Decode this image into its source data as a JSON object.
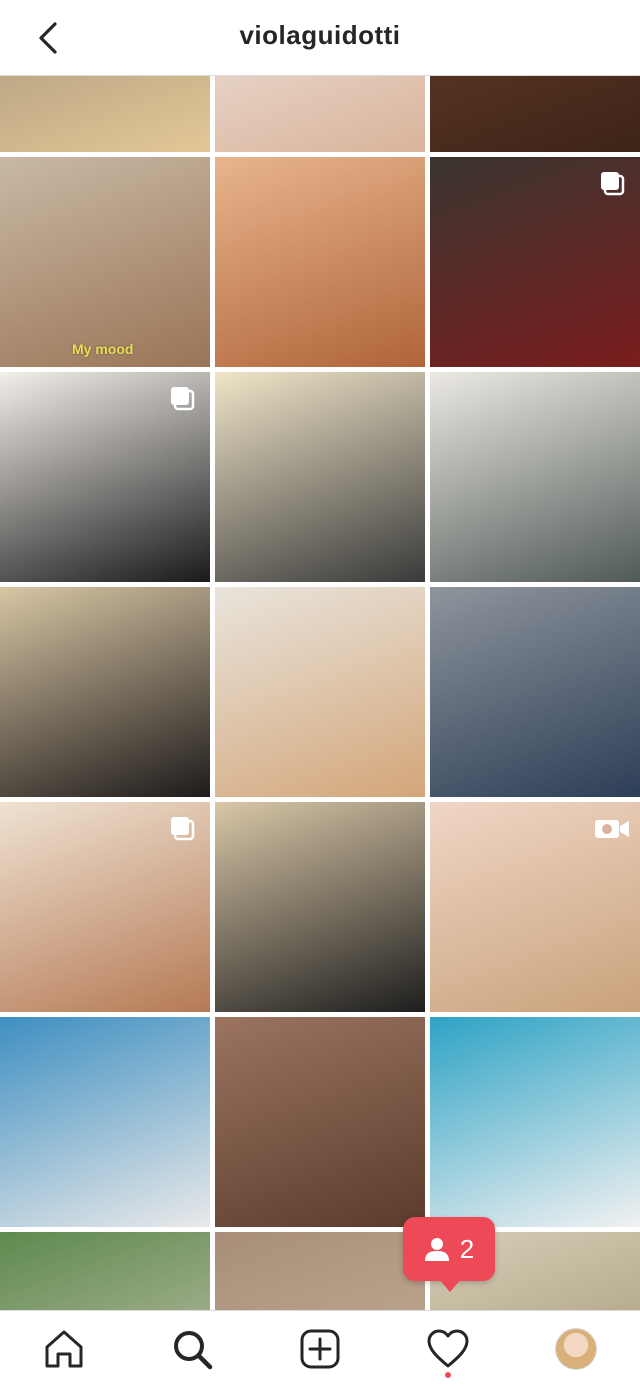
{
  "header": {
    "username": "violaguidotti"
  },
  "grid": {
    "tiles": [
      {
        "colors": [
          "#9c8c78",
          "#e3c896"
        ],
        "overlay": null
      },
      {
        "colors": [
          "#f1ece6",
          "#d9b39b"
        ],
        "overlay": null
      },
      {
        "colors": [
          "#6b3f28",
          "#3d2418"
        ],
        "overlay": null
      },
      {
        "colors": [
          "#c8b9a5",
          "#9b7456"
        ],
        "overlay": null,
        "caption": "My mood"
      },
      {
        "colors": [
          "#e8b58c",
          "#b0643a"
        ],
        "overlay": null
      },
      {
        "colors": [
          "#3a3530",
          "#7a1d1d"
        ],
        "overlay": "carousel-icon"
      },
      {
        "colors": [
          "#f3efea",
          "#1a1a1a"
        ],
        "overlay": "carousel-icon"
      },
      {
        "colors": [
          "#f0e5c8",
          "#3a3a3a"
        ],
        "overlay": null
      },
      {
        "colors": [
          "#ece9e3",
          "#505a57"
        ],
        "overlay": null
      },
      {
        "colors": [
          "#d8c6a4",
          "#1e1b1b"
        ],
        "overlay": null
      },
      {
        "colors": [
          "#e9e4dc",
          "#d3a679"
        ],
        "overlay": null
      },
      {
        "colors": [
          "#8e959c",
          "#2d3e57"
        ],
        "overlay": null
      },
      {
        "colors": [
          "#efe2d2",
          "#b57a55"
        ],
        "overlay": "carousel-icon"
      },
      {
        "colors": [
          "#d9c7a7",
          "#1e1e1e"
        ],
        "overlay": null
      },
      {
        "colors": [
          "#f0d6c6",
          "#c9a27b"
        ],
        "overlay": "camera-icon"
      },
      {
        "colors": [
          "#3e8fc1",
          "#e9e9e9"
        ],
        "overlay": null
      },
      {
        "colors": [
          "#9c7460",
          "#5a3b2c"
        ],
        "overlay": null
      },
      {
        "colors": [
          "#2ea3c5",
          "#f1f1f1"
        ],
        "overlay": null
      },
      {
        "colors": [
          "#5d8a4e",
          "#cfc6b5"
        ],
        "overlay": null
      },
      {
        "colors": [
          "#a88e78",
          "#c7b29c"
        ],
        "overlay": null
      },
      {
        "colors": [
          "#d6ceb8",
          "#9d8f6a"
        ],
        "overlay": null
      }
    ]
  },
  "notification": {
    "count": "2",
    "icon": "person-icon",
    "color": "#ed4956"
  },
  "tabbar": {
    "items": [
      "home-icon",
      "search-icon",
      "new-post-icon",
      "activity-icon",
      "profile-avatar"
    ]
  }
}
